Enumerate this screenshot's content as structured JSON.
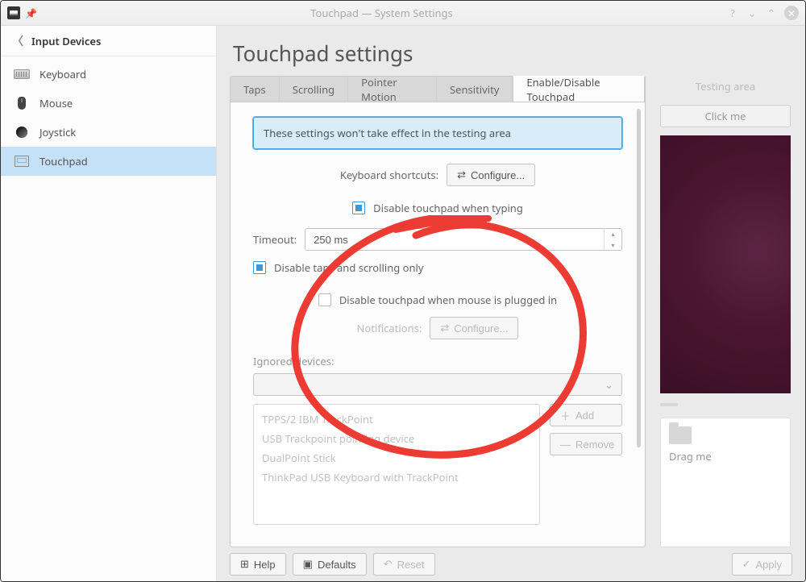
{
  "window": {
    "title": "Touchpad — System Settings"
  },
  "sidebar": {
    "header": "Input Devices",
    "items": [
      {
        "label": "Keyboard"
      },
      {
        "label": "Mouse"
      },
      {
        "label": "Joystick"
      },
      {
        "label": "Touchpad"
      }
    ]
  },
  "page": {
    "title": "Touchpad settings"
  },
  "tabs": [
    {
      "label": "Taps"
    },
    {
      "label": "Scrolling"
    },
    {
      "label": "Pointer Motion"
    },
    {
      "label": "Sensitivity"
    },
    {
      "label": "Enable/Disable Touchpad"
    }
  ],
  "panel": {
    "info": "These settings won't take effect in the testing area",
    "keyboard_shortcuts_label": "Keyboard shortcuts:",
    "configure": "Configure...",
    "disable_typing": "Disable touchpad when typing",
    "timeout_label": "Timeout:",
    "timeout_value": "250 ms",
    "disable_taps_scroll": "Disable taps and scrolling only",
    "disable_mouse": "Disable touchpad when mouse is plugged in",
    "notifications_label": "Notifications:",
    "ignored_label": "Ignored devices:",
    "ignored": [
      "TPPS/2 IBM TrackPoint",
      "USB Trackpoint pointing device",
      "DualPoint Stick",
      "ThinkPad USB Keyboard with TrackPoint"
    ],
    "add": "Add",
    "remove": "Remove"
  },
  "testing": {
    "label": "Testing area",
    "click": "Click me",
    "drag": "Drag me"
  },
  "footer": {
    "help": "Help",
    "defaults": "Defaults",
    "reset": "Reset",
    "apply": "Apply"
  }
}
